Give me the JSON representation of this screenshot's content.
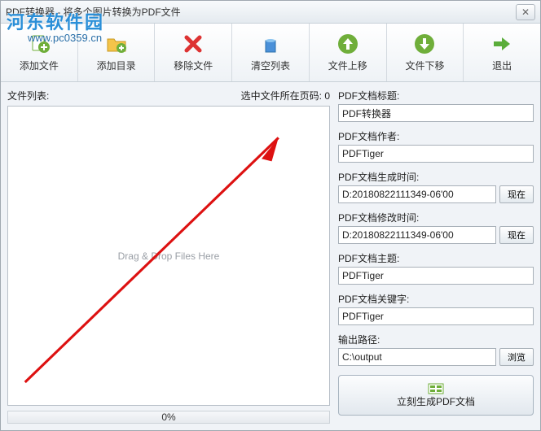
{
  "window": {
    "title": "PDF转换器 - 将多个图片转换为PDF文件"
  },
  "watermark": {
    "line1": "河东软件园",
    "line2": "www.pc0359.cn"
  },
  "toolbar": {
    "add_file": "添加文件",
    "add_dir": "添加目录",
    "remove": "移除文件",
    "clear": "清空列表",
    "move_up": "文件上移",
    "move_down": "文件下移",
    "exit": "退出"
  },
  "left": {
    "file_list_label": "文件列表:",
    "page_label": "选中文件所在页码: 0",
    "drop_hint": "Drag & Drop Files Here",
    "progress": "0%"
  },
  "form": {
    "title_label": "PDF文档标题:",
    "title_value": "PDF转换器",
    "author_label": "PDF文档作者:",
    "author_value": "PDFTiger",
    "ctime_label": "PDF文档生成时间:",
    "ctime_value": "D:20180822111349-06'00",
    "mtime_label": "PDF文档修改时间:",
    "mtime_value": "D:20180822111349-06'00",
    "subject_label": "PDF文档主题:",
    "subject_value": "PDFTiger",
    "keywords_label": "PDF文档关键字:",
    "keywords_value": "PDFTiger",
    "output_label": "输出路径:",
    "output_value": "C:\\output",
    "now_btn": "现在",
    "browse_btn": "浏览"
  },
  "generate": {
    "label": "立刻生成PDF文档"
  }
}
